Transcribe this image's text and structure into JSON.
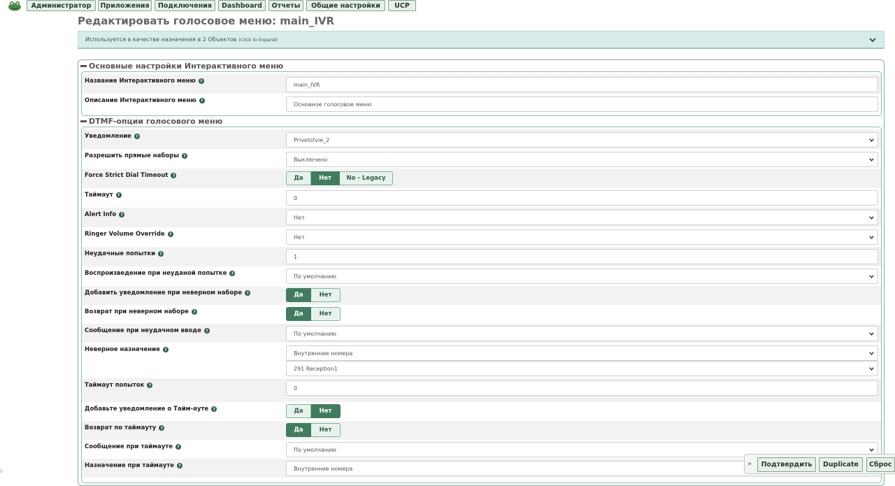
{
  "nav": {
    "logo_icon": "frog-logo-icon",
    "items": [
      {
        "label": "Администратор"
      },
      {
        "label": "Приложения"
      },
      {
        "label": "Подключения"
      },
      {
        "label": "Dashboard"
      },
      {
        "label": "Отчеты"
      },
      {
        "label": "Общие настройки"
      },
      {
        "label": "UCP"
      }
    ]
  },
  "page": {
    "title": "Редактировать голосовое меню: main_IVR",
    "usage_text": "Используется в качестве назначения в 2 Объектов",
    "usage_hint": "(Click to Expand)"
  },
  "sections": {
    "general_title": "Основные настройки Интерактивного меню",
    "dtmf_title": "DTMF-опции голосового меню"
  },
  "fields": {
    "ivr_name": {
      "label": "Название Интерактивного меню",
      "value": "main_IVR"
    },
    "ivr_desc": {
      "label": "Описание Интерактивного меню",
      "value": "Основное голосовое меню"
    },
    "announcement": {
      "label": "Уведомление",
      "value": "Privetstvie_2"
    },
    "direct_dial": {
      "label": "Разрешить прямые наборы",
      "value": "Выключено"
    },
    "strict_timeout": {
      "label": "Force Strict Dial Timeout",
      "options": [
        "Да",
        "Нет",
        "No - Legacy"
      ],
      "selected": "Нет"
    },
    "timeout": {
      "label": "Таймаут",
      "value": "0"
    },
    "alert_info": {
      "label": "Alert Info",
      "value": "Нет"
    },
    "ringer_volume": {
      "label": "Ringer Volume Override",
      "value": "Нет"
    },
    "invalid_retries": {
      "label": "Неудачные попытки",
      "value": "1"
    },
    "invalid_retry_recording": {
      "label": "Воспроизведение при неуданой попытке",
      "value": "По умолчанию"
    },
    "append_invalid_announce": {
      "label": "Добавить уведомление при неверном наборе",
      "options": [
        "Да",
        "Нет"
      ],
      "selected": "Да"
    },
    "return_on_invalid": {
      "label": "Возврат при неверном наборе",
      "options": [
        "Да",
        "Нет"
      ],
      "selected": "Да"
    },
    "invalid_recording": {
      "label": "Сообщение при неудачном вводе",
      "value": "По умолчанию"
    },
    "invalid_destination": {
      "label": "Неверное назначение",
      "value": "Внутренние номера",
      "value2": "291 Reception1"
    },
    "timeout_retries": {
      "label": "Таймаут попыток",
      "value": "0"
    },
    "append_timeout_announce": {
      "label": "Добавьте уведомление о Тайм-ауте",
      "options": [
        "Да",
        "Нет"
      ],
      "selected": "Нет"
    },
    "return_on_timeout": {
      "label": "Возврат по таймауту",
      "options": [
        "Да",
        "Нет"
      ],
      "selected": "Да"
    },
    "timeout_recording": {
      "label": "Сообщение при таймауте",
      "value": "По умолчанию"
    },
    "timeout_destination": {
      "label": "Назначение при таймауте",
      "value": "Внутренние номера"
    }
  },
  "actions": {
    "submit": "Подтвердить",
    "duplicate": "Duplicate",
    "reset": "Сброс"
  },
  "edge_text": "5",
  "colors": {
    "accent": "#3f7d5e",
    "panel_border": "#7fb59a",
    "usage_bg": "#d9ecec"
  }
}
